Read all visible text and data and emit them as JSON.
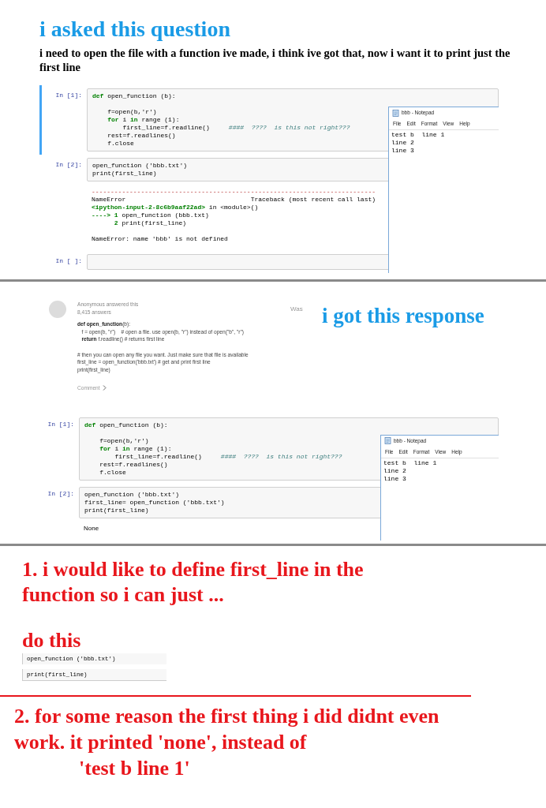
{
  "question": {
    "title": "i asked this question",
    "text": "i  need to open the file with a function ive made, i think ive got that, now i want it to print just the first line"
  },
  "notebook_1": {
    "cells": [
      {
        "prompt": "In [1]:",
        "selected": true,
        "lines": [
          {
            "text": "**def** open_function (b):"
          },
          {
            "text": "    f=open(b,'r')",
            "gap": true
          },
          {
            "text": "    **for** i **in** range (1):"
          },
          {
            "text": "        first_line=f.readline()     ",
            "comment": "####  ????  is this not right???"
          },
          {
            "text": "    rest=f.readlines()"
          },
          {
            "text": "    f.close"
          }
        ]
      },
      {
        "prompt": "In [2]:",
        "selected": false,
        "lines": [
          {
            "text": "open_function ('bbb.txt')"
          },
          {
            "text": "print(first_line)"
          }
        ],
        "output": [
          {
            "text": "---------------------------------------------------------------------------",
            "kind": "rule"
          },
          {
            "text": "NameError                                 Traceback (most recent call last)",
            "kind": "plain"
          },
          {
            "text": "**<ipython-input-2-8c6b9aaf22ad>** in <module>()",
            "kind": "plain"
          },
          {
            "text": "**----> 1** open_function (bbb.txt)",
            "kind": "plain"
          },
          {
            "text": "      **2** print(first_line)",
            "kind": "plain"
          },
          {
            "text": "NameError: name 'bbb' is not defined",
            "kind": "plain",
            "gap": true
          }
        ]
      },
      {
        "prompt": "In [ ]:",
        "selected": false
      }
    ],
    "notepad": {
      "title": "bbb - Notepad",
      "menu": [
        "File",
        "Edit",
        "Format",
        "View",
        "Help"
      ],
      "lines": [
        "test b  line 1",
        "line 2",
        "line 3"
      ]
    }
  },
  "answer": {
    "author": "Anonymous answered this",
    "count": "8,415 answers",
    "side_label": "Was",
    "comment": "Comment",
    "lines": [
      {
        "text": "**def open_function**(b):"
      },
      {
        "text": "   f = open(b, \"r\")    # open a file. use open(b, \"r\") instead of open(\"b\", \"r\")"
      },
      {
        "text": "   **return** f.readline() # returns first line"
      },
      {
        "text": "# then you can open any file you want. Just make sure that file is available",
        "gap": true
      },
      {
        "text": "first_line = open_function('bbb.txt') # get and print first line"
      },
      {
        "text": "print(first_line)"
      }
    ]
  },
  "response_label": "i got this response",
  "notebook_2": {
    "cells": [
      {
        "prompt": "In [1]:",
        "selected": false,
        "lines": [
          {
            "text": "**def** open_function (b):"
          },
          {
            "text": "    f=open(b,'r')",
            "gap": true
          },
          {
            "text": "    **for** i **in** range (1):"
          },
          {
            "text": "        first_line=f.readline()     ",
            "comment": "####  ????  is this not right???"
          },
          {
            "text": "    rest=f.readlines()"
          },
          {
            "text": "    f.close"
          }
        ]
      },
      {
        "prompt": "In [2]:",
        "selected": false,
        "lines": [
          {
            "text": "open_function ('bbb.txt')"
          },
          {
            "text": "first_line= open_function ('bbb.txt')"
          },
          {
            "text": "print(first_line)"
          }
        ],
        "output": [
          {
            "text": "None",
            "kind": "sans"
          }
        ]
      }
    ],
    "notepad": {
      "title": "bbb - Notepad",
      "menu": [
        "File",
        "Edit",
        "Format",
        "View",
        "Help"
      ],
      "lines": [
        "test b  line 1",
        "line 2",
        "line 3"
      ]
    }
  },
  "note_1": {
    "text": "1. i would like to define first_line in the function so i can just ...",
    "example_label": "do this",
    "snippets": [
      {
        "text": "open_function ('bbb.txt')"
      },
      {
        "text": "print(first_line)"
      }
    ]
  },
  "note_2": {
    "text": "2. for some reason the first thing i did didnt even work. it printed 'none', instead of",
    "quote": "'test b line 1'"
  }
}
